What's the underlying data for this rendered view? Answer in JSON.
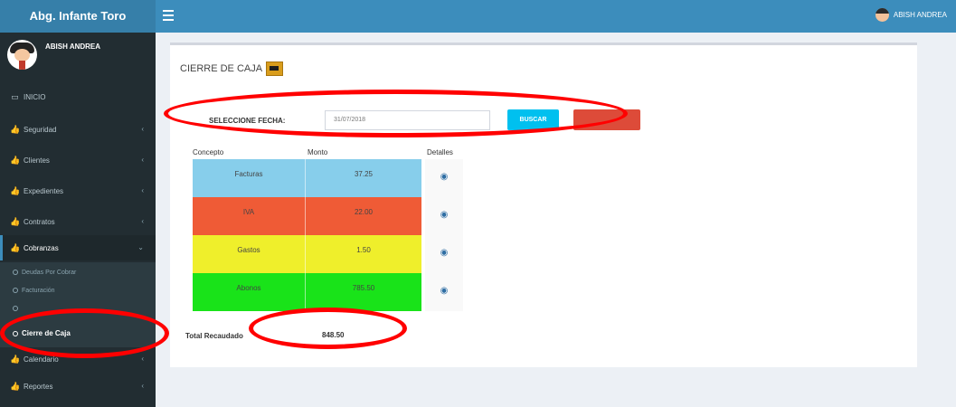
{
  "app": {
    "title": "Abg. Infante Toro",
    "menu_icon": "hamburger-icon",
    "user_name_top": "ABISH ANDREA"
  },
  "sidebar": {
    "user_name": "ABISH ANDREA",
    "items": [
      {
        "label": "INICIO",
        "icon": "monitor-icon"
      },
      {
        "label": "Seguridad",
        "icon": "thumbs-up-icon"
      },
      {
        "label": "Clientes",
        "icon": "thumbs-up-icon"
      },
      {
        "label": "Expedientes",
        "icon": "thumbs-up-icon"
      },
      {
        "label": "Contratos",
        "icon": "thumbs-up-icon"
      },
      {
        "label": "Cobranzas",
        "icon": "thumbs-up-icon"
      },
      {
        "label": "Calendario",
        "icon": "thumbs-up-icon"
      },
      {
        "label": "Reportes",
        "icon": "thumbs-up-icon"
      }
    ],
    "submenu": [
      {
        "label": "Deudas Por Cobrar"
      },
      {
        "label": "Facturación"
      },
      {
        "label": ""
      },
      {
        "label": "Cierre de Caja"
      }
    ]
  },
  "page": {
    "title": "CIERRE DE CAJA",
    "filter_label": "SELECCIONE FECHA:",
    "date_value": "31/07/2018",
    "search_button": "BUSCAR",
    "red_button": "",
    "columns": [
      "Concepto",
      "Monto",
      "Detalles"
    ],
    "rows": [
      {
        "concepto": "Facturas",
        "monto": "37.25",
        "color": "#87ceeb"
      },
      {
        "concepto": "IVA",
        "monto": "22.00",
        "color": "#ef5b36"
      },
      {
        "concepto": "Gastos",
        "monto": "1.50",
        "color": "#efef2b"
      },
      {
        "concepto": "Abonos",
        "monto": "785.50",
        "color": "#19e319"
      }
    ],
    "total_label": "Total Recaudado",
    "total_value": "848.50"
  },
  "colors": {
    "topbar": "#3c8dbc",
    "sidebar": "#222d32",
    "annotation": "#ff0000"
  }
}
